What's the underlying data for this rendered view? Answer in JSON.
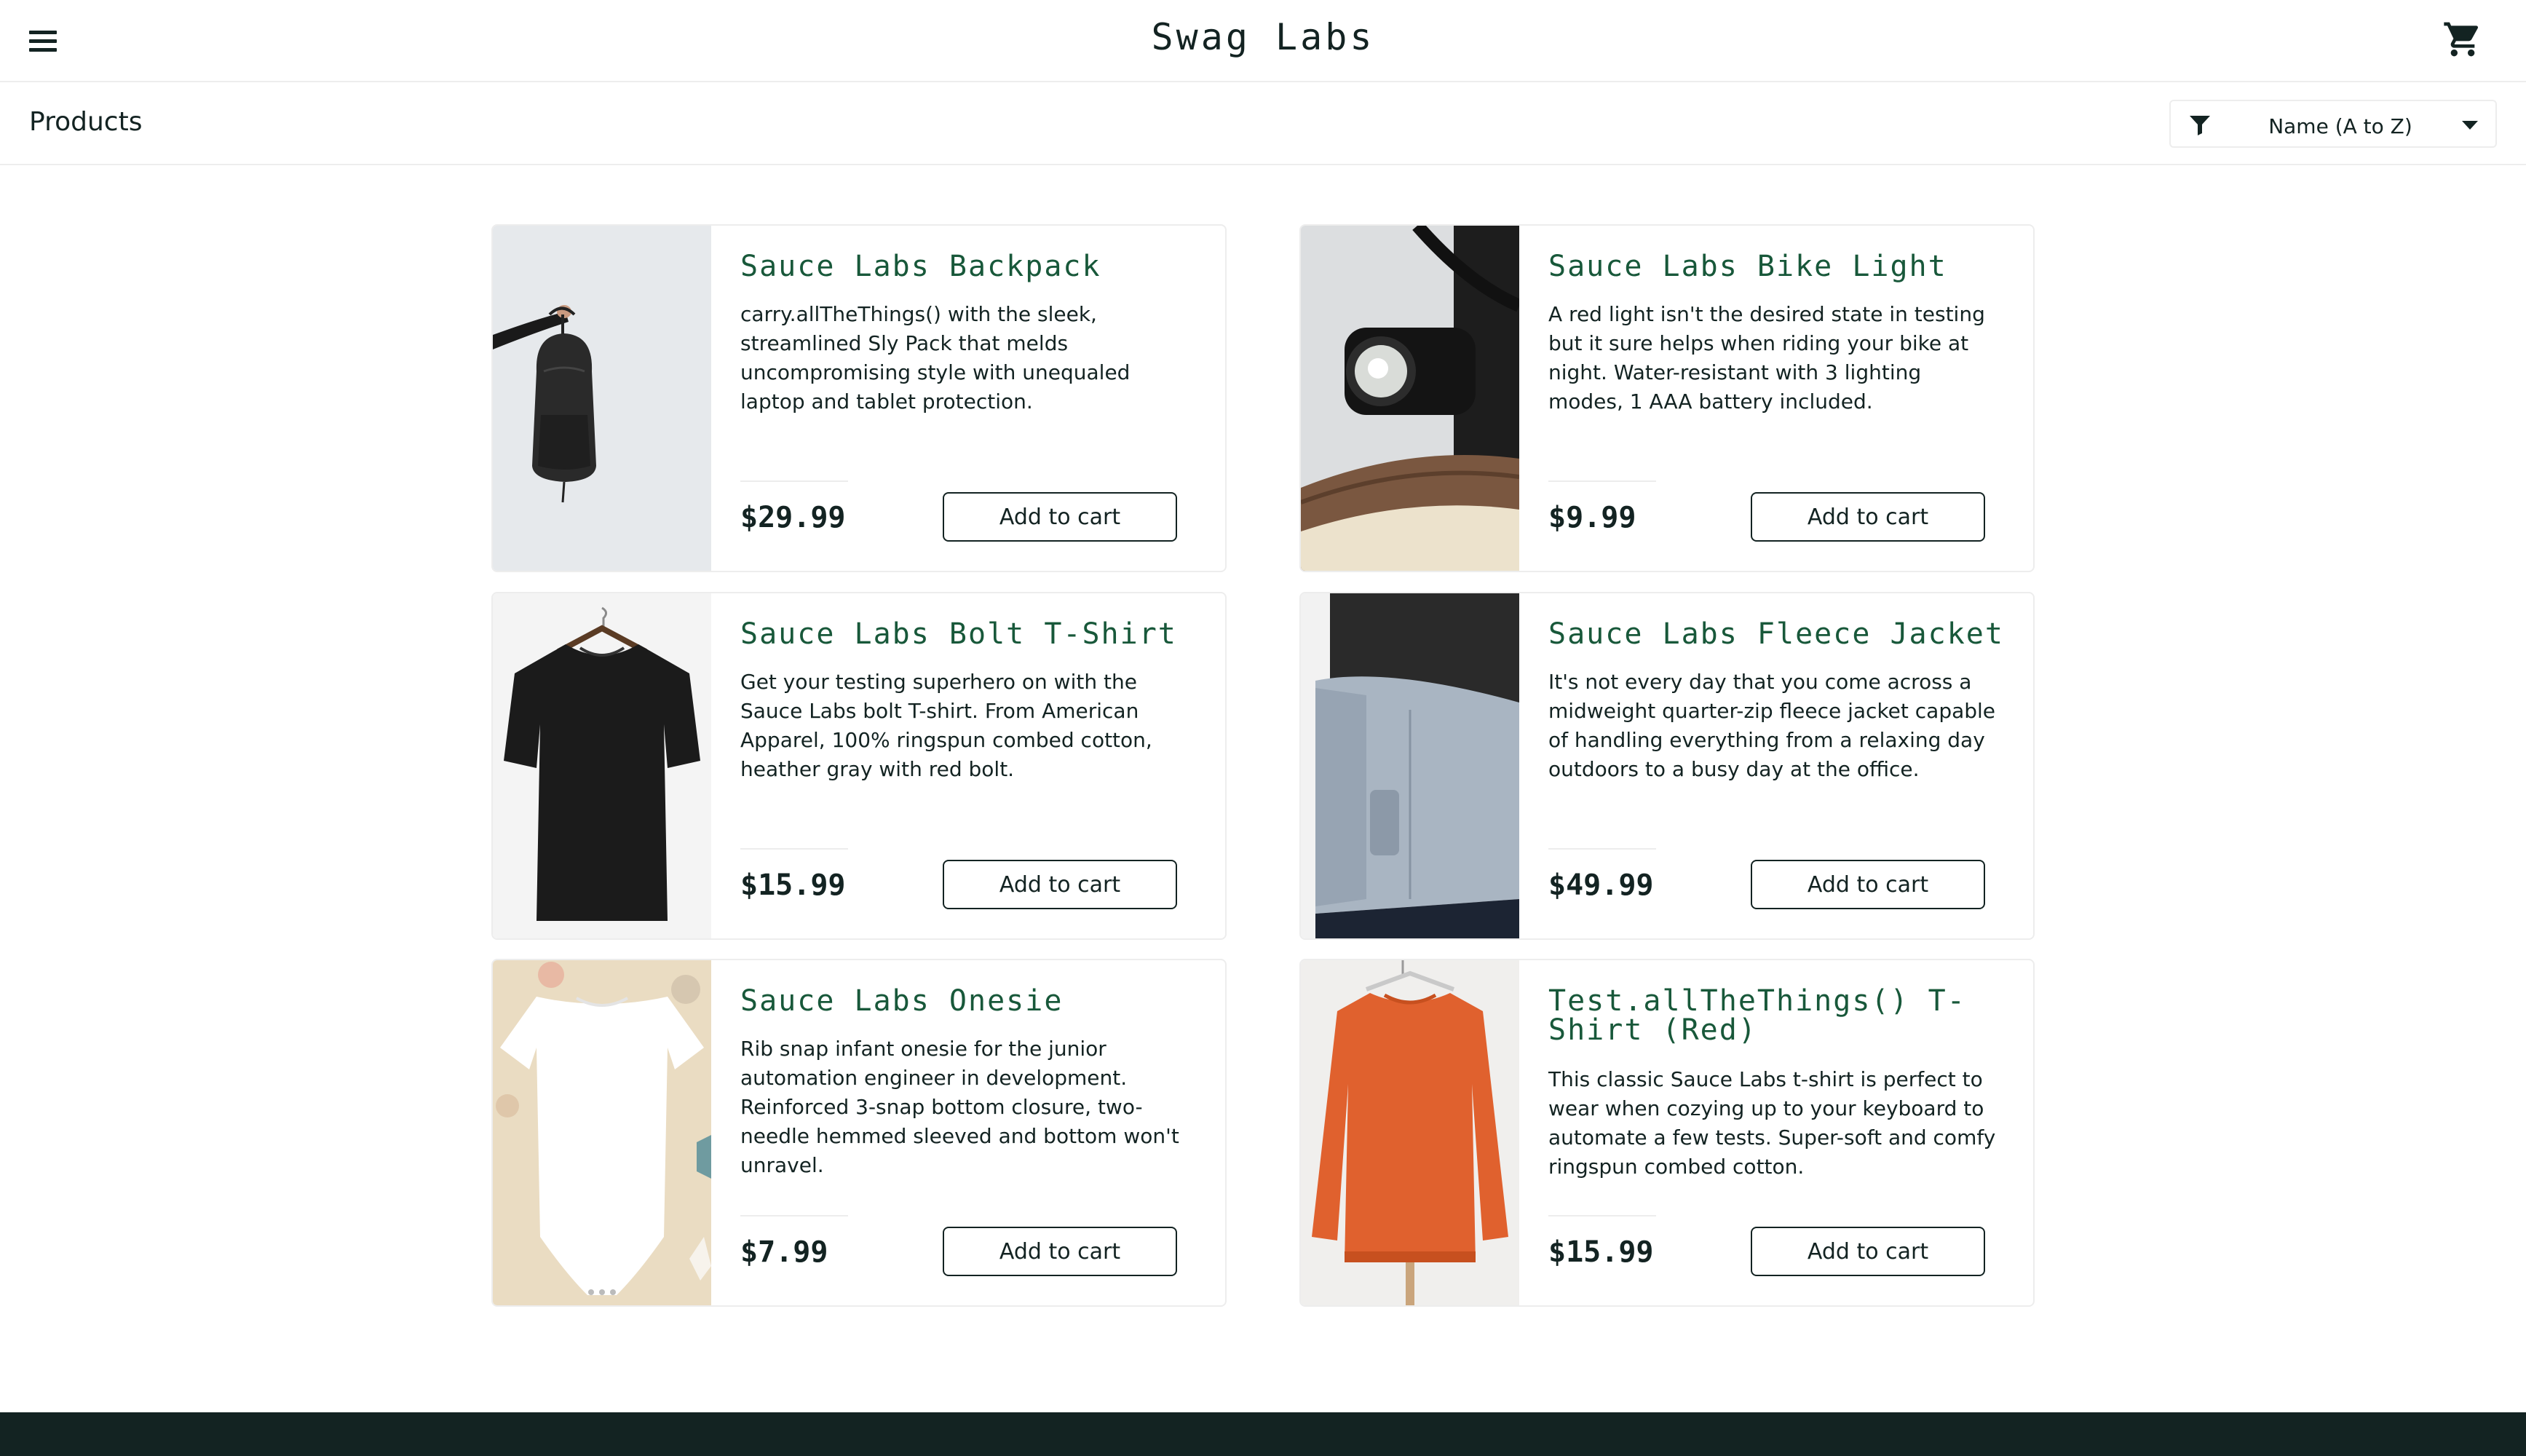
{
  "header": {
    "app_logo": "Swag Labs",
    "menu_icon": "hamburger-menu-icon",
    "cart_icon": "shopping-cart-icon"
  },
  "secondary_header": {
    "title": "Products",
    "sort": {
      "selected": "Name (A to Z)",
      "icon": "filter-icon"
    }
  },
  "products": [
    {
      "name": "Sauce Labs Backpack",
      "description": "carry.allTheThings() with the sleek, streamlined Sly Pack that melds uncompromising style with unequaled laptop and tablet protection.",
      "price": "$29.99",
      "button": "Add to cart",
      "image": "backpack-photo"
    },
    {
      "name": "Sauce Labs Bike Light",
      "description": "A red light isn't the desired state in testing but it sure helps when riding your bike at night. Water-resistant with 3 lighting modes, 1 AAA battery included.",
      "price": "$9.99",
      "button": "Add to cart",
      "image": "bike-light-photo"
    },
    {
      "name": "Sauce Labs Bolt T-Shirt",
      "description": "Get your testing superhero on with the Sauce Labs bolt T-shirt. From American Apparel, 100% ringspun combed cotton, heather gray with red bolt.",
      "price": "$15.99",
      "button": "Add to cart",
      "image": "black-tshirt-photo"
    },
    {
      "name": "Sauce Labs Fleece Jacket",
      "description": "It's not every day that you come across a midweight quarter-zip fleece jacket capable of handling everything from a relaxing day outdoors to a busy day at the office.",
      "price": "$49.99",
      "button": "Add to cart",
      "image": "fleece-jacket-photo"
    },
    {
      "name": "Sauce Labs Onesie",
      "description": "Rib snap infant onesie for the junior automation engineer in development. Reinforced 3-snap bottom closure, two-needle hemmed sleeved and bottom won't unravel.",
      "price": "$7.99",
      "button": "Add to cart",
      "image": "onesie-photo"
    },
    {
      "name": "Test.allTheThings() T-Shirt (Red)",
      "description": "This classic Sauce Labs t-shirt is perfect to wear when cozying up to your keyboard to automate a few tests. Super-soft and comfy ringspun combed cotton.",
      "price": "$15.99",
      "button": "Add to cart",
      "image": "red-sweatshirt-photo"
    }
  ],
  "colors": {
    "brand_dark": "#132322",
    "product_name": "#18583a",
    "border": "#ededed"
  }
}
